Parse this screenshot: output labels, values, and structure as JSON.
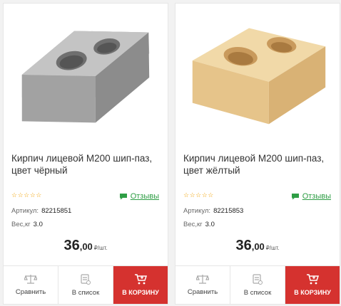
{
  "products": [
    {
      "title": "Кирпич лицевой М200 шип-паз, цвет чёрный",
      "stars": "☆☆☆☆☆",
      "reviews_label": "Отзывы",
      "article_label": "Артикул:",
      "article_value": "82215851",
      "weight_label": "Вес,кг",
      "weight_value": "3.0",
      "price_int": "36",
      "price_dec": ",00",
      "price_unit": "₽/шт.",
      "compare_label": "Сравнить",
      "list_label": "В список",
      "cart_label": "В КОРЗИНУ",
      "image_icon": "grey-brick-image",
      "brick_color": "#9a9a9a"
    },
    {
      "title": "Кирпич лицевой М200 шип-паз, цвет жёлтый",
      "stars": "☆☆☆☆☆",
      "reviews_label": "Отзывы",
      "article_label": "Артикул:",
      "article_value": "82215853",
      "weight_label": "Вес,кг",
      "weight_value": "3.0",
      "price_int": "36",
      "price_dec": ",00",
      "price_unit": "₽/шт.",
      "compare_label": "Сравнить",
      "list_label": "В список",
      "cart_label": "В КОРЗИНУ",
      "image_icon": "yellow-brick-image",
      "brick_color": "#e8c78f"
    }
  ],
  "colors": {
    "accent_red": "#d5322f",
    "review_green": "#2e9e45",
    "star_orange": "#f0a000"
  }
}
